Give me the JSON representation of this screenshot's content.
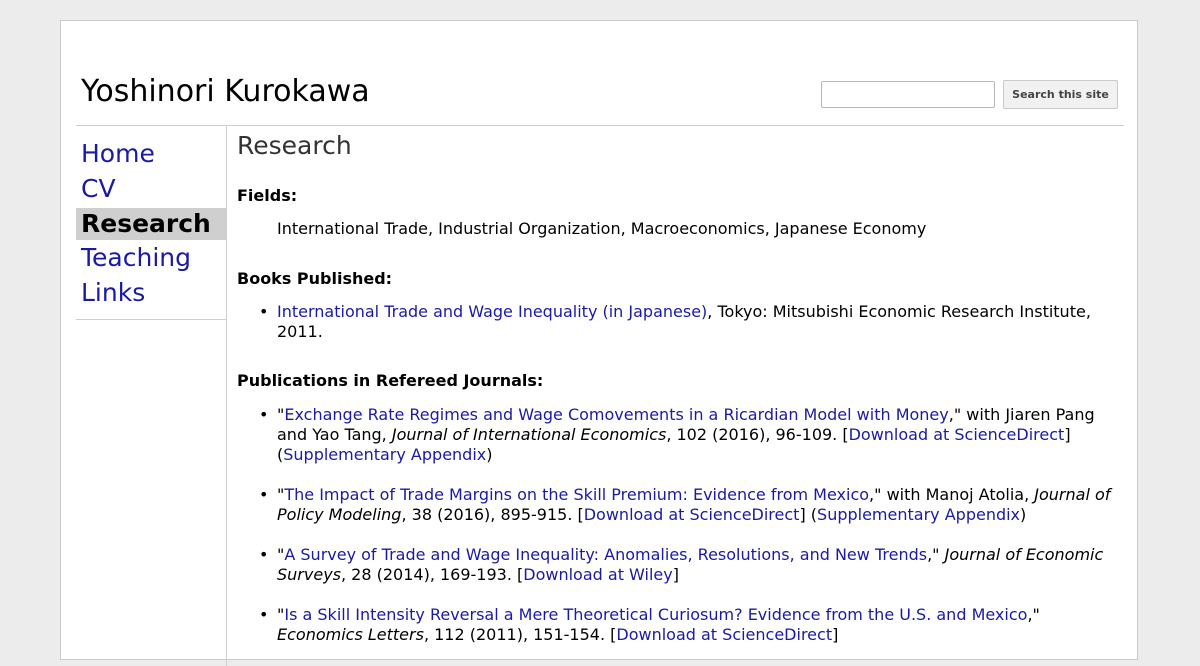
{
  "site": {
    "title": "Yoshinori Kurokawa",
    "search_placeholder": "",
    "search_button": "Search this site"
  },
  "nav": {
    "items": [
      {
        "label": "Home",
        "active": false
      },
      {
        "label": "CV",
        "active": false
      },
      {
        "label": "Research",
        "active": true
      },
      {
        "label": "Teaching",
        "active": false
      },
      {
        "label": "Links",
        "active": false
      }
    ]
  },
  "main": {
    "title": "Research",
    "fields": {
      "heading": "Fields:",
      "text": "International Trade, Industrial Organization, Macroeconomics, Japanese Economy"
    },
    "books": {
      "heading": "Books Published:",
      "items": [
        {
          "link": "International Trade and Wage Inequality (in Japanese)",
          "rest": ", Tokyo: Mitsubishi Economic Research Institute, 2011."
        }
      ]
    },
    "journals": {
      "heading": "Publications in Refereed Journals:",
      "items": [
        {
          "open_quote": "\"",
          "link": "Exchange Rate Regimes and Wage Comovements in a Ricardian Model with Money",
          "after_link": ",\" with Jiaren Pang and Yao Tang, ",
          "journal": "Journal of International Economics",
          "details": ", 102 (2016), 96-109.  [",
          "download": "Download at ScienceDirect",
          "close_bracket": "]",
          "appendix_open": " (",
          "appendix": "Supplementary Appendix",
          "appendix_close": ")"
        },
        {
          "open_quote": "\"",
          "link": "The Impact of Trade Margins on the Skill Premium: Evidence from Mexico",
          "after_link": ",\" with Manoj Atolia, ",
          "journal": "Journal of Policy Modeling",
          "details": ", 38 (2016), 895-915.  [",
          "download": "Download at ScienceDirect",
          "close_bracket": "]",
          "appendix_open": "  (",
          "appendix": "Supplementary Appendix",
          "appendix_close": ")"
        },
        {
          "open_quote": "\"",
          "link": "A Survey of Trade and Wage Inequality: Anomalies, Resolutions, and New Trends",
          "after_link": ",\" ",
          "journal": "Journal of Economic Surveys",
          "details": ", 28 (2014), 169-193.  [",
          "download": "Download at Wiley",
          "close_bracket": "]",
          "appendix_open": "",
          "appendix": "",
          "appendix_close": ""
        },
        {
          "open_quote": "\"",
          "link": "Is a Skill Intensity Reversal a Mere Theoretical Curiosum? Evidence from the U.S. and Mexico",
          "after_link": ",\" ",
          "journal": "Economics Letters",
          "details": ", 112 (2011), 151-154.  [",
          "download": "Download at ScienceDirect",
          "close_bracket": "]",
          "appendix_open": "",
          "appendix": "",
          "appendix_close": ""
        }
      ]
    }
  }
}
